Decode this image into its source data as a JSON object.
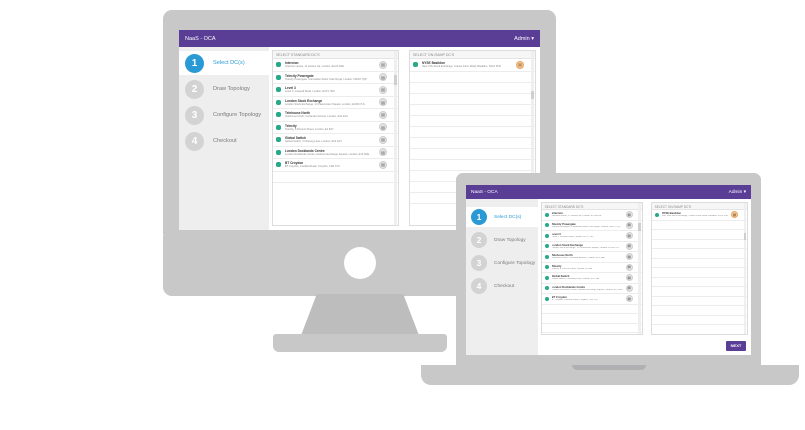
{
  "app": {
    "title": "NaaS - OCA",
    "user_menu": "Admin"
  },
  "steps": [
    {
      "num": "1",
      "label": "Select DC(s)"
    },
    {
      "num": "2",
      "label": "Draw Topology"
    },
    {
      "num": "3",
      "label": "Configure Topology"
    },
    {
      "num": "4",
      "label": "Checkout"
    }
  ],
  "standard_panel": {
    "title": "Select Standard DC's",
    "items": [
      {
        "name": "Interxion",
        "address": "Interxion House, 11 Hoxton Sq, London, EC2A 4SE"
      },
      {
        "name": "Telecity Powergate",
        "address": "Telecity Powergate, Coronation Road, Park Royal, London, NW10 7QP"
      },
      {
        "name": "Level 3",
        "address": "Level 3, Goswell Road, London, EC1V 7EX"
      },
      {
        "name": "London Stock Exchange",
        "address": "London Stock Exchange, 10 Paternoster Square, London, EC4M 7LS"
      },
      {
        "name": "Telehouse North",
        "address": "Telehouse North, Coriander Avenue, London, E14 2AA"
      },
      {
        "name": "Telecity",
        "address": "Telecity, 8 Prescot Street, London, E1 8AY"
      },
      {
        "name": "Global Switch",
        "address": "Global Switch, 3 Nutmeg Lane, London, E14 2AX"
      },
      {
        "name": "London Docklands Centre",
        "address": "London Docklands Centre, Harbour Exchange Square, London, E14 9GE"
      },
      {
        "name": "BT Croydon",
        "address": "BT Croydon, Fairfield Road, Croydon, CR0 1XX"
      }
    ],
    "action_icon": "trash-icon"
  },
  "onramp_panel": {
    "title": "Select On-Ramp DC's",
    "items": [
      {
        "name": "NYSE Basildon",
        "address": "New York Stock Exchange, Cranes Farm Road, Basildon, SS14 3FR"
      }
    ],
    "action_icon": "trash-icon"
  },
  "actions": {
    "next_label": "NEXT"
  },
  "colors": {
    "brand": "#5a3e96",
    "accent": "#2a9ad6",
    "check": "#27a88a",
    "onramp_button": "#f6c99a"
  }
}
